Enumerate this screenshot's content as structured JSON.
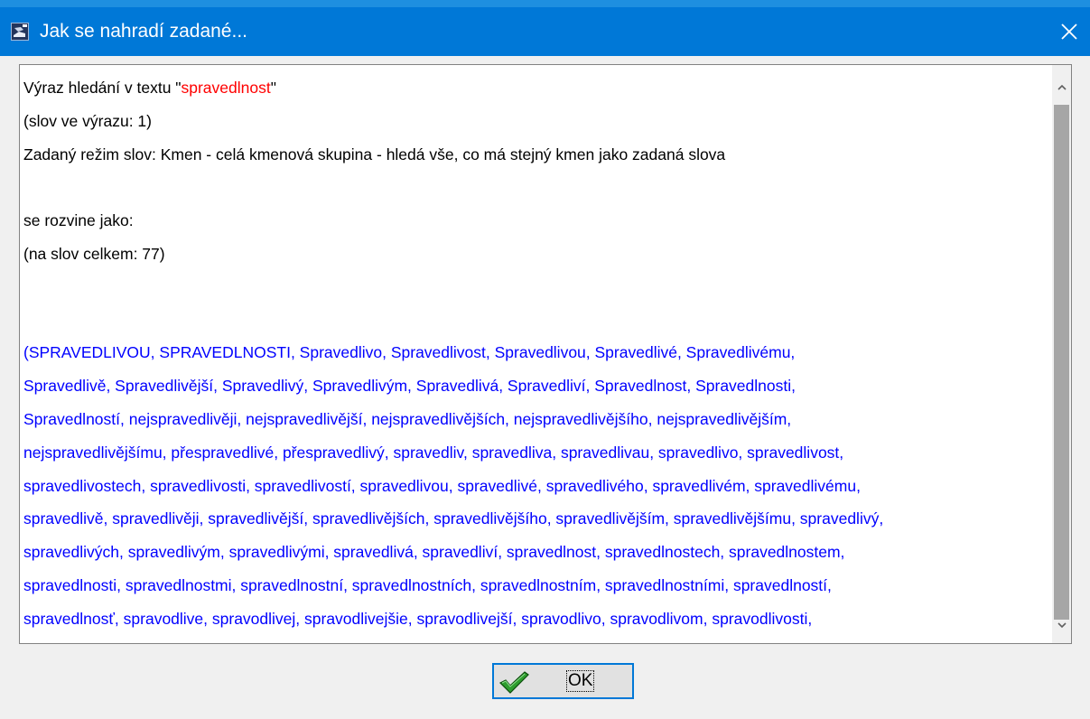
{
  "window": {
    "title": "Jak se nahradí zadané..."
  },
  "content": {
    "line1_prefix": "Výraz hledání v textu \"",
    "search_term": "spravedlnost",
    "line1_suffix": "\"",
    "word_count": "(slov ve výrazu: 1)",
    "mode": "Zadaný režim slov: Kmen - celá kmenová skupina - hledá vše, co má stejný kmen jako zadaná slova",
    "expands_as": "se rozvine jako:",
    "total_words": "(na slov celkem: 77)",
    "word_lines": [
      "(SPRAVEDLIVOU, SPRAVEDLNOSTI, Spravedlivo, Spravedlivost, Spravedlivou, Spravedlivé, Spravedlivému,",
      "Spravedlivě, Spravedlivější, Spravedlivý, Spravedlivým, Spravedlivá, Spravedliví, Spravedlnost, Spravedlnosti,",
      "Spravedlností, nejspravedlivěji, nejspravedlivější, nejspravedlivějších, nejspravedlivějšího, nejspravedlivějším,",
      "nejspravedlivějšímu, přespravedlivé, přespravedlivý, spravedliv, spravedliva, spravedlivau, spravedlivo, spravedlivost,",
      "spravedlivostech, spravedlivosti, spravedlivostí, spravedlivou, spravedlivé, spravedlivého, spravedlivém, spravedlivému,",
      "spravedlivě, spravedlivěji, spravedlivější, spravedlivějších, spravedlivějšího, spravedlivějším, spravedlivějšímu, spravedlivý,",
      "spravedlivých, spravedlivým, spravedlivými, spravedlivá, spravedliví, spravedlnost, spravedlnostech, spravedlnostem,",
      "spravedlnosti, spravedlnostmi, spravedlnostní, spravedlnostních, spravedlnostním, spravedlnostními, spravedlností,",
      "spravedlnosť, spravodlive, spravodlivej, spravodlivejšie, spravodlivejší, spravodlivo, spravodlivom, spravodlivosti,"
    ]
  },
  "colors": {
    "titlebar": "#0078d7",
    "search_term": "#ff0000",
    "word_list": "#0000ff"
  },
  "buttons": {
    "ok_label": "OK"
  }
}
